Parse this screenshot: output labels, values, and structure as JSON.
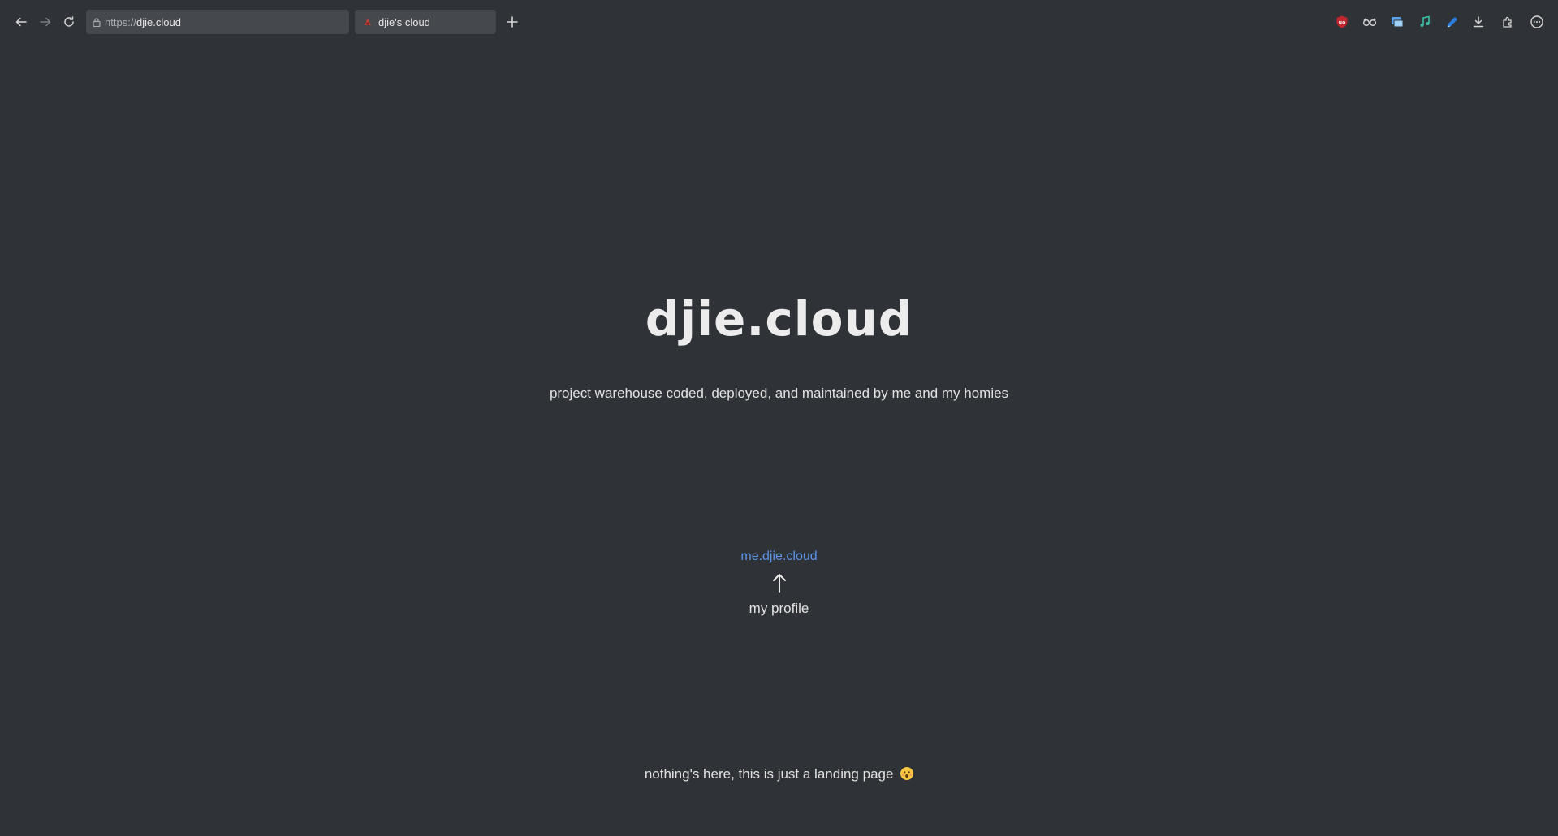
{
  "browser": {
    "url_scheme": "https://",
    "url_host": "djie.cloud",
    "tab_title": "djie's cloud",
    "nav": {
      "back_icon": "arrow-left-icon",
      "forward_icon": "arrow-right-icon",
      "reload_icon": "reload-icon",
      "new_tab_icon": "plus-icon"
    },
    "extensions": [
      {
        "name": "ublock-icon",
        "color": "#c0262d"
      },
      {
        "name": "glasses-icon",
        "color": "#c7c9cc"
      },
      {
        "name": "window-icon",
        "color": "#5ba3e6"
      },
      {
        "name": "music-icon",
        "color": "#3cbfa4"
      },
      {
        "name": "pen-icon",
        "color": "#2e7de0"
      },
      {
        "name": "download-icon",
        "color": "#d6d6d6"
      },
      {
        "name": "puzzle-icon",
        "color": "#d6d6d6"
      },
      {
        "name": "menu-icon",
        "color": "#d6d6d6"
      }
    ]
  },
  "page": {
    "title": "djie.cloud",
    "subtitle": "project warehouse coded, deployed, and maintained by me and my homies",
    "profile_link": "me.djie.cloud",
    "profile_caption": "my profile",
    "footer": "nothing's here, this is just a landing page",
    "link_color": "#5d95e8"
  }
}
